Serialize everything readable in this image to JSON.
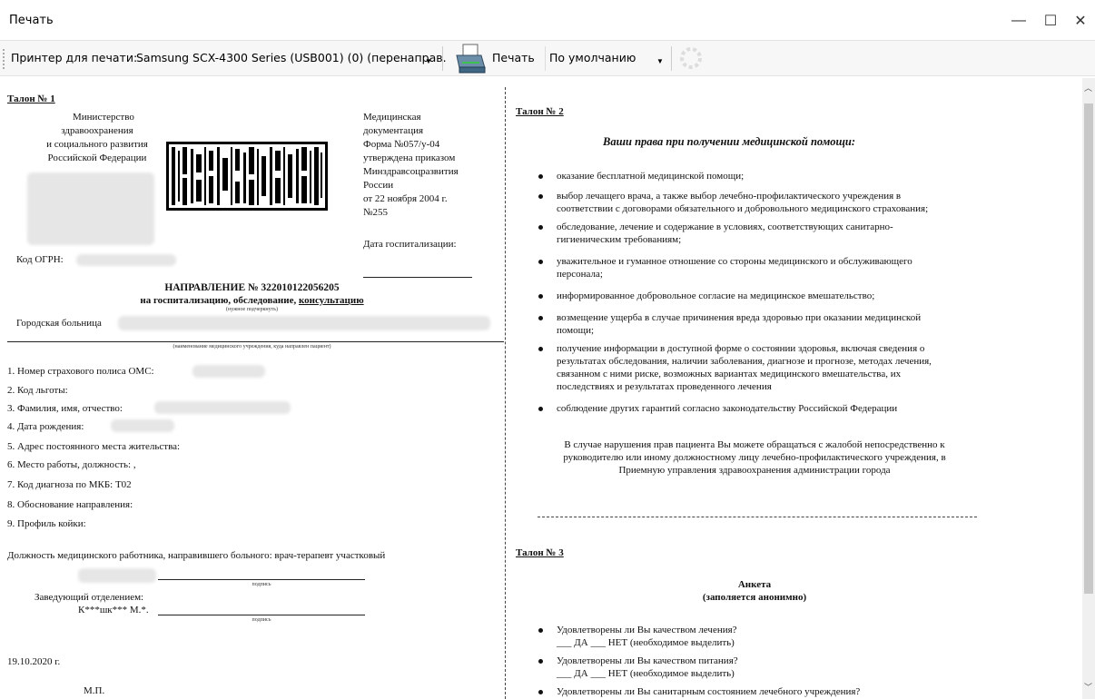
{
  "window": {
    "title": "Печать",
    "minimize": "—",
    "maximize": "☐",
    "close": "✕"
  },
  "toolbar": {
    "printer_label": "Принтер для печати:",
    "printer_value": "Samsung SCX-4300 Series (USB001) (0) (перенаправ.",
    "print_label": "Печать",
    "mode_value": "По умолчанию"
  },
  "left": {
    "talon": "Талон № 1",
    "ministry": [
      "Министерство",
      "здравоохранения",
      "и социального развития",
      "Российской Федерации"
    ],
    "doc": [
      "Медицинская",
      "документация",
      "Форма №057/у-04",
      "утверждена приказом",
      "Минздравсоцразвития",
      "России",
      "от 22 ноября 2004 г.",
      "№255"
    ],
    "hosp_date": "Дата госпитализации:",
    "ogrn": "Код ОГРН:",
    "direction_title": "НАПРАВЛЕНИЕ № 322010122056205",
    "direction_sub_a": "на госпитализацию,  обследование,  ",
    "direction_sub_b": "консультацию",
    "small_note": "(нужное подчеркнуть)",
    "hospital": "Городская больница",
    "small_inst": "(наименование медицинского учреждения, куда направлен пациент)",
    "items": [
      "1.   Номер страхового полиса ОМС:",
      "2.   Код льготы:",
      "3.   Фамилия, имя, отчество:",
      "4.   Дата рождения:",
      "5.   Адрес постоянного места жительства:",
      "6.   Место работы, должность: ,",
      "7.   Код диагноза по МКБ: T02",
      "8.   Обоснование направления:",
      "9.   Профиль койки:"
    ],
    "position": "Должность медицинского работника, направившего больного: врач-терапевт участковый",
    "sign": "подпись",
    "head_label": "Заведующий отделением:",
    "head_name": "К***шк*** М.*.",
    "date": "19.10.2020 г.",
    "mp": "М.П."
  },
  "right": {
    "talon2": "Талон № 2",
    "rights_title": "Ваши права при получении медицинской помощи:",
    "rights": [
      "оказание бесплатной медицинской помощи;",
      "выбор лечащего врача, а также выбор лечебно-профилактического учреждения в",
      "соответствии с договорами обязательного и добровольного медицинского страхования;",
      "обследование, лечение и содержание в условиях, соответствующих санитарно-",
      "гигиеническим требованиям;",
      "уважительное и гуманное отношение со стороны медицинского и обслуживающего",
      "персонала;",
      "информированное добровольное согласие на медицинское вмешательство;",
      "возмещение ущерба в случае причинения вреда здоровью при оказании медицинской",
      "помощи;",
      "получение информации в доступной форме о состоянии здоровья, включая сведения о",
      "результатах обследования, наличии заболевания, диагнозе и прогнозе, методах лечения,",
      "связанном с ними риске, возможных вариантах медицинского вмешательства, их",
      "последствиях и результатах проведенного лечения",
      "соблюдение других гарантий согласно законодательству Российской Федерации"
    ],
    "complaint": [
      "В случае нарушения прав пациента Вы можете обращаться с жалобой непосредственно к",
      "руководителю или иному должностному лицу лечебно-профилактического учреждения, в",
      "Приемную управления здравоохранения администрации города"
    ],
    "talon3": "Талон № 3",
    "survey_title": "Анкета",
    "survey_sub": "(заполяется анонимно)",
    "q": [
      "Удовлетворены ли Вы качеством лечения?",
      "___ ДА     ___ НЕТ (необходимое выделить)",
      "Удовлетворены ли Вы качеством питания?",
      "___ ДА     ___ НЕТ (необходимое выделить)",
      "Удовлетворены ли Вы санитарным состоянием лечебного учреждения?"
    ]
  }
}
